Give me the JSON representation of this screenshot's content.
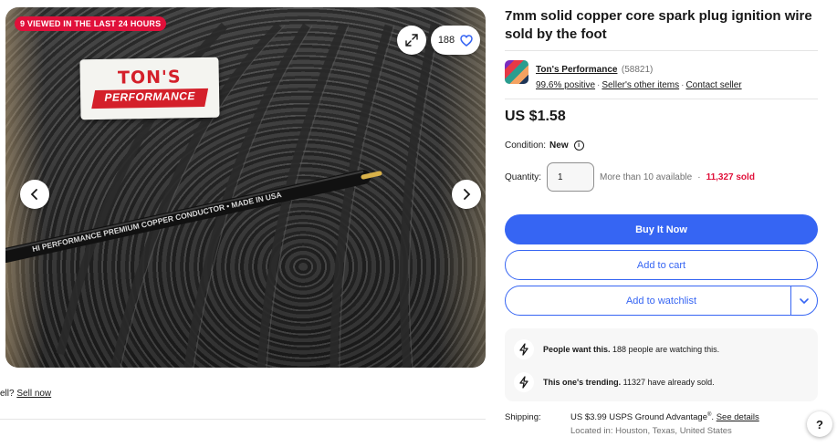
{
  "gallery": {
    "viewed_badge": "9 VIEWED IN THE LAST 24 HOURS",
    "logo_top": "TON'S",
    "logo_bottom": "PERFORMANCE",
    "wire_text": "HI PERFORMANCE PREMIUM COPPER CONDUCTOR  •  MADE IN USA",
    "watch_count": "188",
    "icons": [
      "expand-icon",
      "heart-icon",
      "chevron-left-icon",
      "chevron-right-icon"
    ]
  },
  "left": {
    "sell_prefix": "ell?",
    "sell_link": "Sell now"
  },
  "listing": {
    "title": "7mm solid copper core spark plug ignition wire sold by the foot",
    "seller": {
      "name": "Ton's Performance",
      "count": "(58821)",
      "positive": "99.6% positive",
      "other_items": "Seller's other items",
      "contact": "Contact seller"
    },
    "price": "US $1.58",
    "condition_label": "Condition:",
    "condition_value": "New",
    "quantity_label": "Quantity:",
    "quantity_value": "1",
    "available": "More than 10 available",
    "sold": "11,327 sold",
    "buttons": {
      "buy": "Buy It Now",
      "cart": "Add to cart",
      "watch": "Add to watchlist"
    },
    "signals": [
      {
        "bold": "People want this.",
        "text": "188 people are watching this.",
        "icon": "lightning-icon"
      },
      {
        "bold": "This one's trending.",
        "text": "11327 have already sold.",
        "icon": "lightning-icon"
      }
    ],
    "shipping": {
      "label": "Shipping:",
      "cost": "US $3.99 USPS Ground Advantage",
      "reg": "®",
      "details_link": "See details",
      "location": "Located in: Houston, Texas, United States"
    }
  },
  "help_label": "?",
  "colors": {
    "accent": "#3665f3",
    "badge": "#e0103a",
    "sold_red": "#e0103a",
    "logo_red": "#d4202a"
  }
}
